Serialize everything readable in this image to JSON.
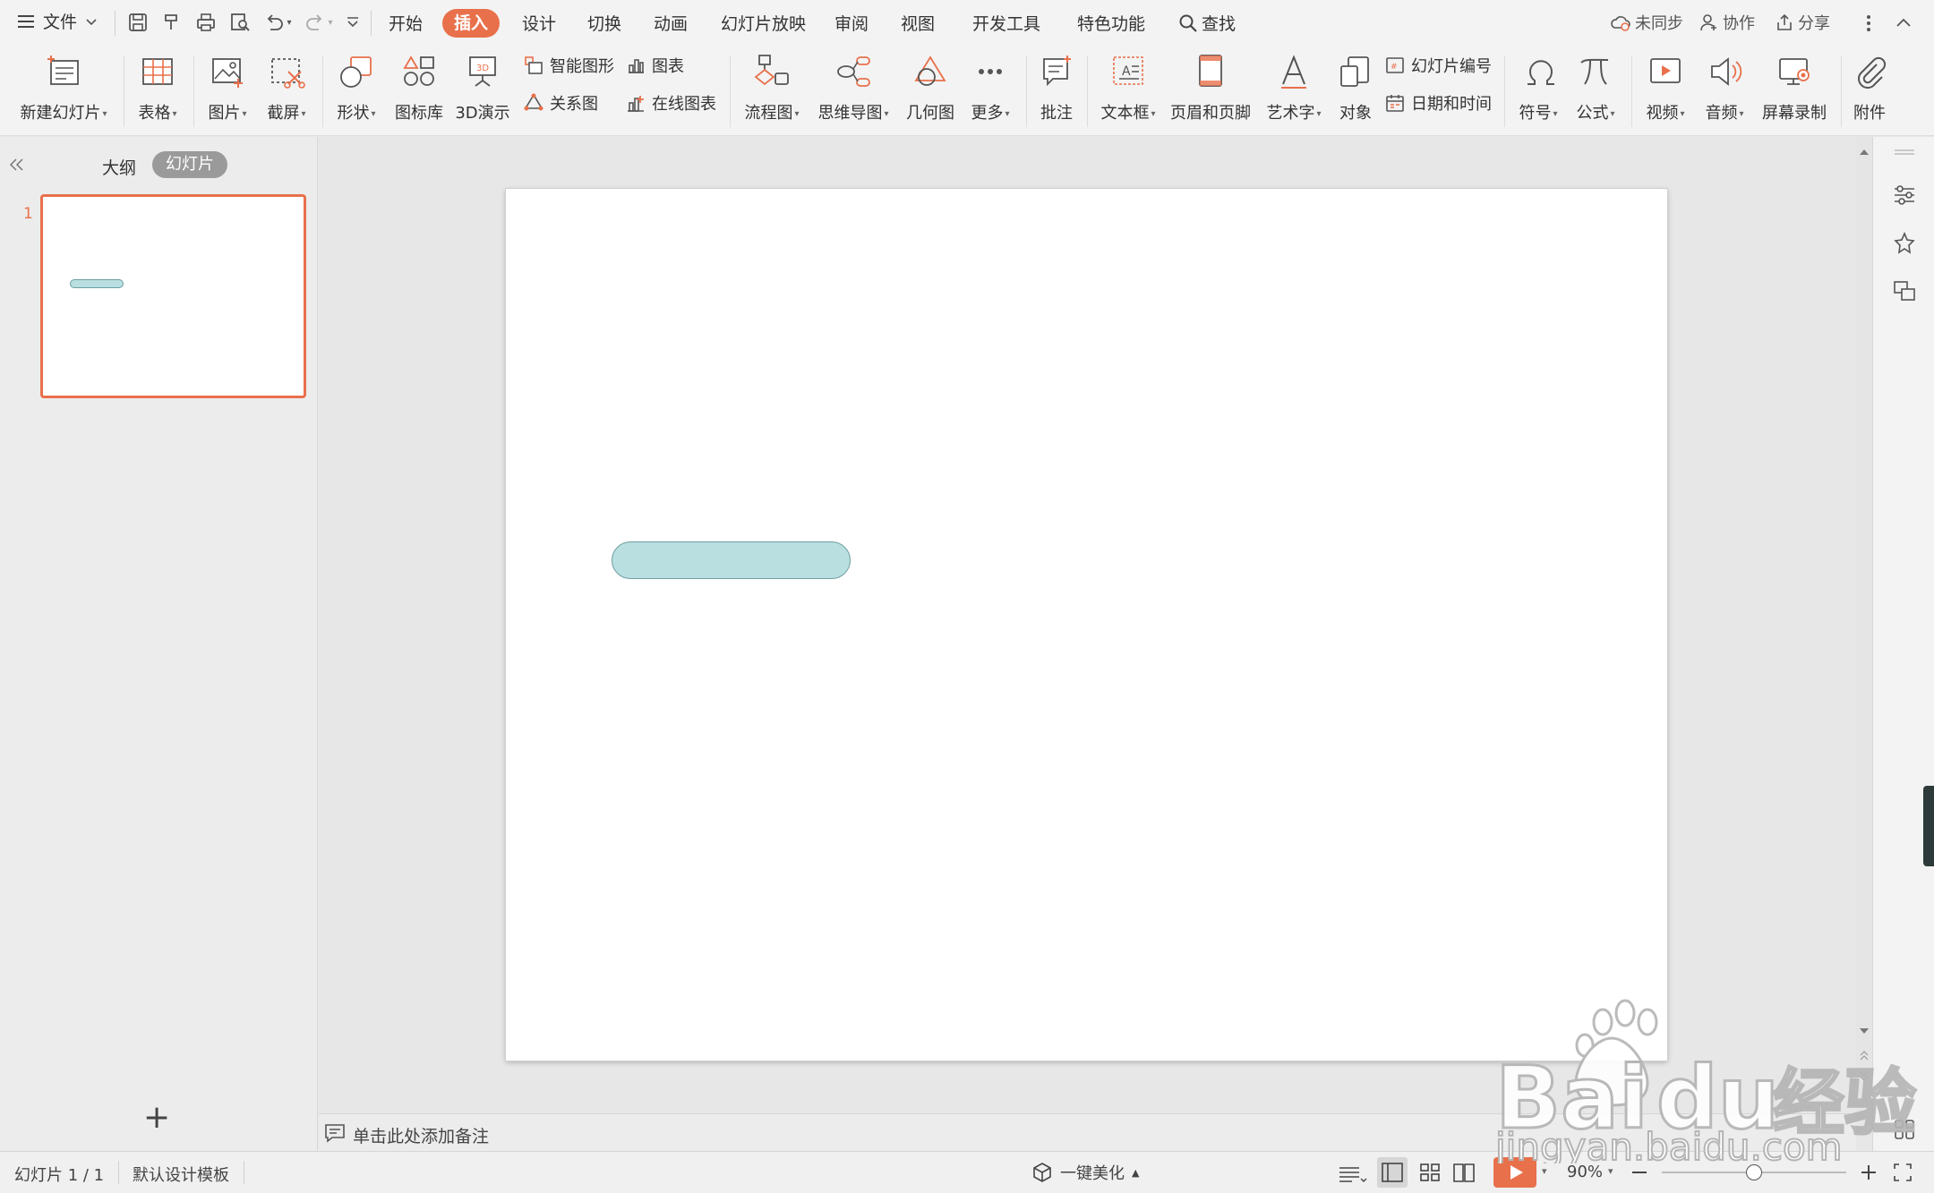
{
  "menubar": {
    "file_label": "文件",
    "tabs": [
      {
        "label": "开始"
      },
      {
        "label": "插入",
        "active": true
      },
      {
        "label": "设计"
      },
      {
        "label": "切换"
      },
      {
        "label": "动画"
      },
      {
        "label": "幻灯片放映"
      },
      {
        "label": "审阅"
      },
      {
        "label": "视图"
      },
      {
        "label": "开发工具"
      },
      {
        "label": "特色功能"
      }
    ],
    "search_label": "查找",
    "sync_label": "未同步",
    "collab_label": "协作",
    "share_label": "分享",
    "accent_color": "#e8704b"
  },
  "ribbon": {
    "new_slide": "新建幻灯片",
    "table": "表格",
    "picture": "图片",
    "screenshot": "截屏",
    "shape": "形状",
    "icon_library": "图标库",
    "demo3d": "3D演示",
    "smart_art": "智能图形",
    "chart": "图表",
    "relation": "关系图",
    "online_chart": "在线图表",
    "flowchart": "流程图",
    "mindmap": "思维导图",
    "geometry": "几何图",
    "more": "更多",
    "comment": "批注",
    "textbox": "文本框",
    "header_footer": "页眉和页脚",
    "wordart": "艺术字",
    "object": "对象",
    "slide_number": "幻灯片编号",
    "date_time": "日期和时间",
    "symbol": "符号",
    "formula": "公式",
    "video": "视频",
    "audio": "音频",
    "screen_record": "屏幕录制",
    "attachment": "附件"
  },
  "left_panel": {
    "tab_outline": "大纲",
    "tab_slides": "幻灯片",
    "slide_number": "1",
    "add_symbol": "+"
  },
  "slide": {
    "shape_fill": "#b9dfe0",
    "shape_border": "#6f9ea2"
  },
  "notes": {
    "placeholder": "单击此处添加备注"
  },
  "statusbar": {
    "slide_info": "幻灯片 1 / 1",
    "template": "默认设计模板",
    "beautify": "一键美化",
    "zoom": "90%",
    "zoom_fraction": 0.5
  },
  "watermark": {
    "brand": "Bai du 经验",
    "url": "jingyan.baidu.com"
  }
}
